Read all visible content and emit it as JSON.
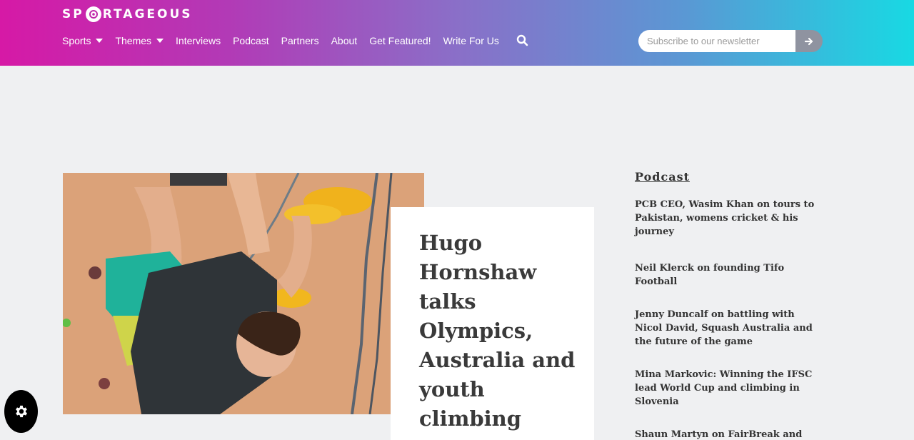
{
  "brand": {
    "logo_left": "SP",
    "logo_right": "RTAGEOUS"
  },
  "nav": {
    "items": [
      {
        "label": "Sports",
        "dropdown": true
      },
      {
        "label": "Themes",
        "dropdown": true
      },
      {
        "label": "Interviews",
        "dropdown": false
      },
      {
        "label": "Podcast",
        "dropdown": false
      },
      {
        "label": "Partners",
        "dropdown": false
      },
      {
        "label": "About",
        "dropdown": false
      },
      {
        "label": "Get Featured!",
        "dropdown": false
      },
      {
        "label": "Write For Us",
        "dropdown": false
      }
    ],
    "search_icon": "search-icon"
  },
  "newsletter": {
    "placeholder": "Subscribe to our newsletter",
    "submit_icon": "arrow-right-icon"
  },
  "article": {
    "title": "Hugo Hornshaw talks Olympics, Australia and youth climbing"
  },
  "sidebar": {
    "heading": "Podcast",
    "links": [
      "PCB CEO, Wasim Khan on tours to Pakistan, womens cricket & his journey",
      "Neil Klerck on founding Tifo Football",
      "Jenny Duncalf on battling with Nicol David, Squash Australia and the future of the game",
      "Mina Markovic: Winning the IFSC lead World Cup and climbing in Slovenia",
      "Shaun Martyn on FairBreak and the future of women’s cricket"
    ]
  },
  "settings_button": {
    "icon": "gear-icon"
  },
  "colors": {
    "header_start": "#d619a6",
    "header_end": "#18d9e3",
    "page_bg": "#eff0f2",
    "title_text": "#3a3a3a"
  }
}
